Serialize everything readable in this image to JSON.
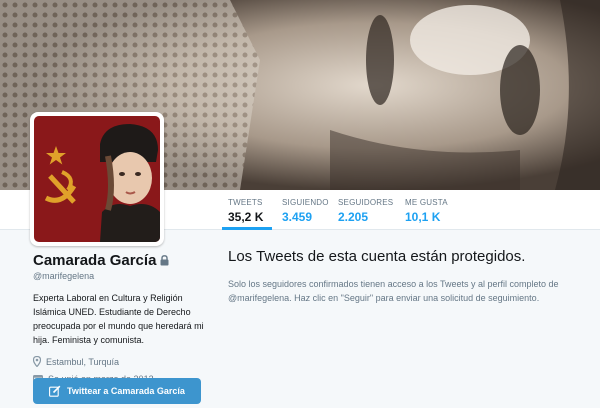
{
  "banner": {
    "alt": "header-photo"
  },
  "avatar": {
    "alt": "profile-photo"
  },
  "stats": [
    {
      "label": "TWEETS",
      "value": "35,2 K",
      "active": true
    },
    {
      "label": "SIGUIENDO",
      "value": "3.459",
      "active": false
    },
    {
      "label": "SEGUIDORES",
      "value": "2.205",
      "active": false
    },
    {
      "label": "ME GUSTA",
      "value": "10,1 K",
      "active": false
    }
  ],
  "profile": {
    "name": "Camarada García",
    "handle": "@marifegelena",
    "bio": "Experta Laboral en Cultura y Religión Islámica UNED. Estudiante de Derecho preocupada por el mundo que heredará mi hija. Feminista y comunista.",
    "location": "Estambul, Turquía",
    "joined": "Se unió en marzo de 2013",
    "tweet_button": "Twittear a Camarada García",
    "icons": {
      "lock": "lock-icon",
      "location": "location-pin-icon",
      "calendar": "calendar-icon",
      "compose": "compose-icon"
    }
  },
  "protected": {
    "title": "Los Tweets de esta cuenta están protegidos.",
    "body": "Solo los seguidores confirmados tienen acceso a los Tweets y al perfil completo de @marifegelena. Haz clic en \"Seguir\" para enviar una solicitud de seguimiento."
  },
  "colors": {
    "accent": "#1da1f2",
    "button": "#3d95ce",
    "muted": "#657786"
  }
}
